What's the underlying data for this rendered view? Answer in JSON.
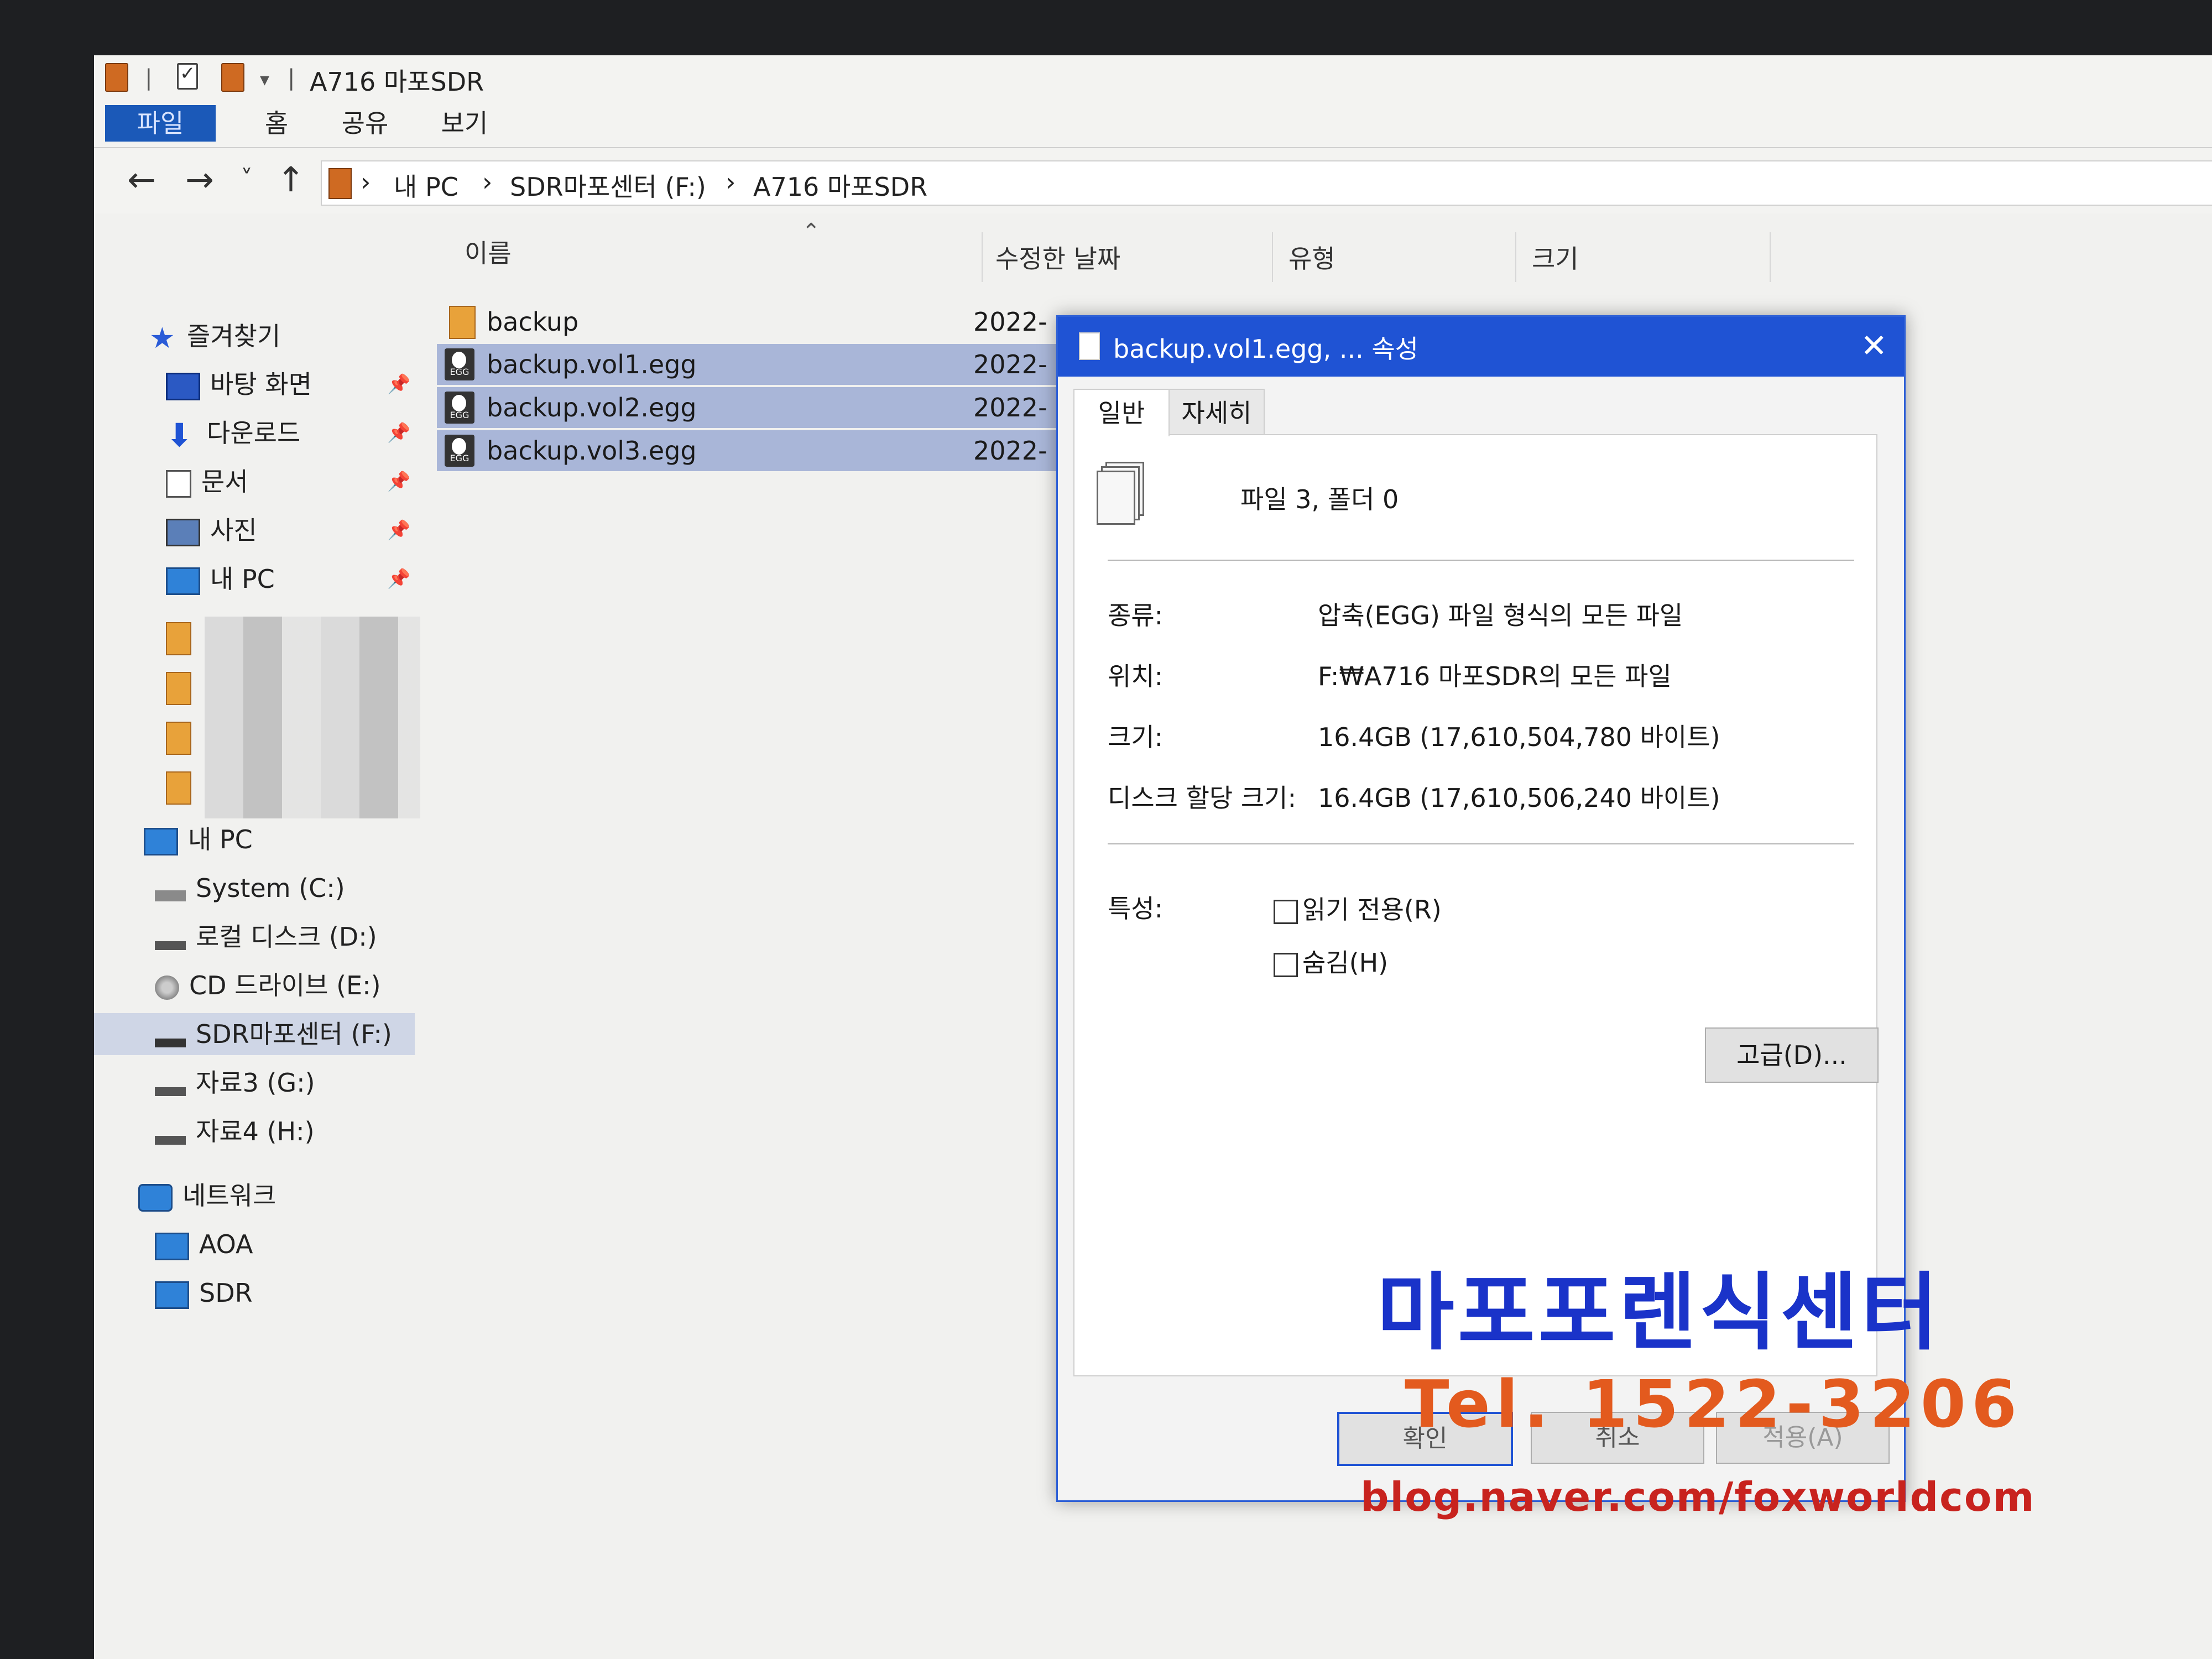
{
  "window": {
    "title": "A716 마포SDR"
  },
  "ribbon": {
    "tabs": [
      "파일",
      "홈",
      "공유",
      "보기"
    ]
  },
  "nav": {
    "back": "←",
    "forward": "→",
    "recent": "˅",
    "up": "↑",
    "breadcrumbs": [
      "내 PC",
      "SDR마포센터 (F:)",
      "A716 마포SDR"
    ],
    "separator": "›"
  },
  "sidebar": {
    "quick_access": "즐겨찾기",
    "pinned": [
      "바탕 화면",
      "다운로드",
      "문서",
      "사진",
      "내 PC"
    ],
    "this_pc": "내 PC",
    "drives": [
      "System (C:)",
      "로컬 디스크 (D:)",
      "CD 드라이브 (E:)",
      "SDR마포센터 (F:)",
      "자료3 (G:)",
      "자료4 (H:)"
    ],
    "selected_drive": "SDR마포센터 (F:)",
    "network": "네트워크",
    "network_items": [
      "AOA",
      "SDR"
    ]
  },
  "filelist": {
    "columns": [
      "이름",
      "수정한 날짜",
      "유형",
      "크기"
    ],
    "rows": [
      {
        "name": "backup",
        "date": "2022-",
        "selected": false,
        "kind": "folder"
      },
      {
        "name": "backup.vol1.egg",
        "date": "2022-",
        "selected": true,
        "kind": "egg"
      },
      {
        "name": "backup.vol2.egg",
        "date": "2022-",
        "selected": true,
        "kind": "egg"
      },
      {
        "name": "backup.vol3.egg",
        "date": "2022-",
        "selected": true,
        "kind": "egg"
      }
    ]
  },
  "dialog": {
    "title": "backup.vol1.egg, ... 속성",
    "close": "✕",
    "tabs": [
      "일반",
      "자세히"
    ],
    "summary": "파일 3, 폴더 0",
    "props": [
      {
        "label": "종류:",
        "value": "압축(EGG) 파일 형식의 모든 파일"
      },
      {
        "label": "위치:",
        "value": "F:₩A716 마포SDR의 모든 파일"
      },
      {
        "label": "크기:",
        "value": "16.4GB (17,610,504,780 바이트)"
      },
      {
        "label": "디스크 할당 크기:",
        "value": "16.4GB (17,610,506,240 바이트)"
      }
    ],
    "attributes_label": "특성:",
    "readonly": "읽기 전용(R)",
    "hidden": "숨김(H)",
    "advanced": "고급(D)...",
    "ok": "확인",
    "cancel": "취소",
    "apply": "적용(A)"
  },
  "watermark": {
    "name": "마포포렌식센터",
    "tel": "Tel. 1522-3206",
    "blog": "blog.naver.com/foxworldcom"
  },
  "colors": {
    "accent": "#1f53d4",
    "selection": "#a9b6d8",
    "file_tab": "#1b59b8"
  }
}
